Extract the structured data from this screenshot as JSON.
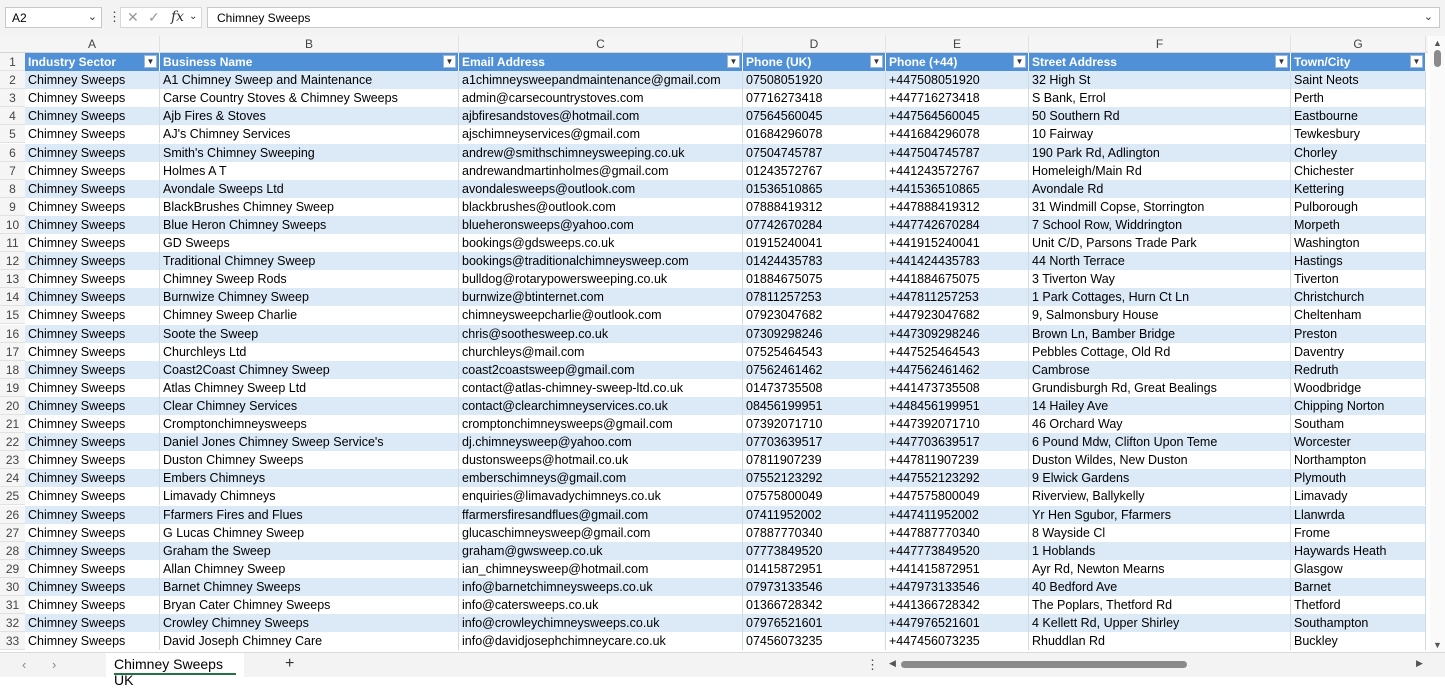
{
  "formula_bar": {
    "name_box": "A2",
    "fx_label": "fx",
    "value": "Chimney Sweeps"
  },
  "columns": [
    "A",
    "B",
    "C",
    "D",
    "E",
    "F",
    "G"
  ],
  "headers": [
    "Industry Sector",
    "Business Name",
    "Email Address",
    "Phone (UK)",
    "Phone (+44)",
    "Street Address",
    "Town/City"
  ],
  "rows": [
    [
      "Chimney Sweeps",
      "A1 Chimney Sweep and Maintenance",
      "a1chimneysweepandmaintenance@gmail.com",
      "07508051920",
      "+447508051920",
      "32 High St",
      "Saint Neots"
    ],
    [
      "Chimney Sweeps",
      "Carse Country Stoves & Chimney Sweeps",
      "admin@carsecountrystoves.com",
      "07716273418",
      "+447716273418",
      "S Bank, Errol",
      "Perth"
    ],
    [
      "Chimney Sweeps",
      "Ajb Fires & Stoves",
      "ajbfiresandstoves@hotmail.com",
      "07564560045",
      "+447564560045",
      "50 Southern Rd",
      "Eastbourne"
    ],
    [
      "Chimney Sweeps",
      "AJ's Chimney Services",
      "ajschimneyservices@gmail.com",
      "01684296078",
      "+441684296078",
      "10 Fairway",
      "Tewkesbury"
    ],
    [
      "Chimney Sweeps",
      "Smith's Chimney Sweeping",
      "andrew@smithschimneysweeping.co.uk",
      "07504745787",
      "+447504745787",
      "190 Park Rd, Adlington",
      "Chorley"
    ],
    [
      "Chimney Sweeps",
      "Holmes A T",
      "andrewandmartinholmes@gmail.com",
      "01243572767",
      "+441243572767",
      "Homeleigh/Main Rd",
      "Chichester"
    ],
    [
      "Chimney Sweeps",
      "Avondale Sweeps Ltd",
      "avondalesweeps@outlook.com",
      "01536510865",
      "+441536510865",
      "Avondale Rd",
      "Kettering"
    ],
    [
      "Chimney Sweeps",
      "BlackBrushes Chimney Sweep",
      "blackbrushes@outlook.com",
      "07888419312",
      "+447888419312",
      "31 Windmill Copse, Storrington",
      "Pulborough"
    ],
    [
      "Chimney Sweeps",
      "Blue Heron Chimney Sweeps",
      "blueheronsweeps@yahoo.com",
      "07742670284",
      "+447742670284",
      "7 School Row, Widdrington",
      "Morpeth"
    ],
    [
      "Chimney Sweeps",
      "GD Sweeps",
      "bookings@gdsweeps.co.uk",
      "01915240041",
      "+441915240041",
      "Unit C/D, Parsons Trade Park",
      "Washington"
    ],
    [
      "Chimney Sweeps",
      "Traditional Chimney Sweep",
      "bookings@traditionalchimneysweep.com",
      "01424435783",
      "+441424435783",
      "44 North Terrace",
      "Hastings"
    ],
    [
      "Chimney Sweeps",
      "Chimney Sweep Rods",
      "bulldog@rotarypowersweeping.co.uk",
      "01884675075",
      "+441884675075",
      "3 Tiverton Way",
      "Tiverton"
    ],
    [
      "Chimney Sweeps",
      "Burnwize Chimney Sweep",
      "burnwize@btinternet.com",
      "07811257253",
      "+447811257253",
      "1 Park Cottages, Hurn Ct Ln",
      "Christchurch"
    ],
    [
      "Chimney Sweeps",
      "Chimney Sweep Charlie",
      "chimneysweepcharlie@outlook.com",
      "07923047682",
      "+447923047682",
      "9, Salmonsbury House",
      "Cheltenham"
    ],
    [
      "Chimney Sweeps",
      "Soote the Sweep",
      "chris@soothesweep.co.uk",
      "07309298246",
      "+447309298246",
      "Brown Ln, Bamber Bridge",
      "Preston"
    ],
    [
      "Chimney Sweeps",
      "Churchleys Ltd",
      "churchleys@mail.com",
      "07525464543",
      "+447525464543",
      "Pebbles Cottage, Old Rd",
      "Daventry"
    ],
    [
      "Chimney Sweeps",
      "Coast2Coast Chimney Sweep",
      "coast2coastsweep@gmail.com",
      "07562461462",
      "+447562461462",
      "Cambrose",
      "Redruth"
    ],
    [
      "Chimney Sweeps",
      "Atlas Chimney Sweep Ltd",
      "contact@atlas-chimney-sweep-ltd.co.uk",
      "01473735508",
      "+441473735508",
      "Grundisburgh Rd, Great Bealings",
      "Woodbridge"
    ],
    [
      "Chimney Sweeps",
      "Clear Chimney Services",
      "contact@clearchimneyservices.co.uk",
      "08456199951",
      "+448456199951",
      "14 Hailey Ave",
      "Chipping Norton"
    ],
    [
      "Chimney Sweeps",
      "Cromptonchimneysweeps",
      "cromptonchimneysweeps@gmail.com",
      "07392071710",
      "+447392071710",
      "46 Orchard Way",
      "Southam"
    ],
    [
      "Chimney Sweeps",
      "Daniel Jones Chimney Sweep Service's",
      "dj.chimneysweep@yahoo.com",
      "07703639517",
      "+447703639517",
      "6 Pound Mdw, Clifton Upon Teme",
      "Worcester"
    ],
    [
      "Chimney Sweeps",
      "Duston Chimney Sweeps",
      "dustonsweeps@hotmail.co.uk",
      "07811907239",
      "+447811907239",
      "Duston Wildes, New Duston",
      "Northampton"
    ],
    [
      "Chimney Sweeps",
      "Embers Chimneys",
      "emberschimneys@gmail.com",
      "07552123292",
      "+447552123292",
      "9 Elwick Gardens",
      "Plymouth"
    ],
    [
      "Chimney Sweeps",
      "Limavady Chimneys",
      "enquiries@limavadychimneys.co.uk",
      "07575800049",
      "+447575800049",
      "Riverview, Ballykelly",
      "Limavady"
    ],
    [
      "Chimney Sweeps",
      "Ffarmers Fires and Flues",
      "ffarmersfiresandflues@gmail.com",
      "07411952002",
      "+447411952002",
      "Yr Hen Sgubor, Ffarmers",
      "Llanwrda"
    ],
    [
      "Chimney Sweeps",
      "G Lucas Chimney Sweep",
      "glucaschimneysweep@gmail.com",
      "07887770340",
      "+447887770340",
      "8 Wayside Cl",
      "Frome"
    ],
    [
      "Chimney Sweeps",
      "Graham the Sweep",
      "graham@gwsweep.co.uk",
      "07773849520",
      "+447773849520",
      "1 Hoblands",
      "Haywards Heath"
    ],
    [
      "Chimney Sweeps",
      "Allan Chimney Sweep",
      "ian_chimneysweep@hotmail.com",
      "01415872951",
      "+441415872951",
      "Ayr Rd, Newton Mearns",
      "Glasgow"
    ],
    [
      "Chimney Sweeps",
      "Barnet Chimney Sweeps",
      "info@barnetchimneysweeps.co.uk",
      "07973133546",
      "+447973133546",
      "40 Bedford Ave",
      "Barnet"
    ],
    [
      "Chimney Sweeps",
      "Bryan Cater Chimney Sweeps",
      "info@catersweeps.co.uk",
      "01366728342",
      "+441366728342",
      "The Poplars, Thetford Rd",
      "Thetford"
    ],
    [
      "Chimney Sweeps",
      "Crowley Chimney Sweeps",
      "info@crowleychimneysweeps.co.uk",
      "07976521601",
      "+447976521601",
      "4 Kellett Rd, Upper Shirley",
      "Southampton"
    ],
    [
      "Chimney Sweeps",
      "David Joseph Chimney Care",
      "info@davidjosephchimneycare.co.uk",
      "07456073235",
      "+447456073235",
      "Rhuddlan Rd",
      "Buckley"
    ]
  ],
  "sheet_tab": "Chimney Sweeps UK",
  "colors": {
    "header_fill": "#4f90d6",
    "band_fill": "#dce9f7",
    "tab_underline": "#217346"
  }
}
